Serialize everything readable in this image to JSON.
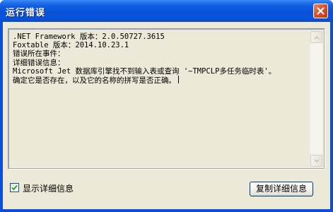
{
  "window": {
    "title": "运行错误"
  },
  "message": {
    "lines": [
      ".NET Framework 版本：2.0.50727.3615",
      "Foxtable 版本：2014.10.23.1",
      "错误所在事件：",
      "详细错误信息：",
      "Microsoft Jet 数据库引擎找不到输入表或查询 '~TMPCLP多任务临时表'。",
      "确定它是否存在，以及它的名称的拼写是否正确。"
    ]
  },
  "details_checkbox": {
    "label": "显示详细信息",
    "checked": true
  },
  "copy_button": {
    "label": "复制详细信息"
  },
  "colors": {
    "titlebar": "#0852D9",
    "client": "#ECE9D8",
    "close_button": "#D9532C"
  },
  "icons": {
    "close": "close-icon",
    "scroll_up": "chevron-up-icon",
    "scroll_down": "chevron-down-icon",
    "check": "checkmark-icon"
  }
}
